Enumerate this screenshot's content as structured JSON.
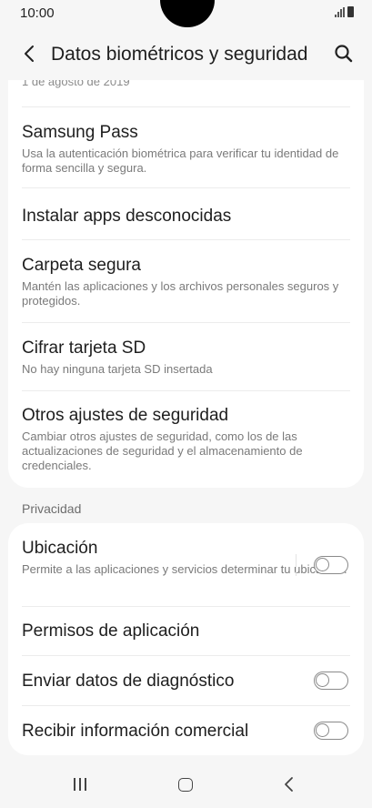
{
  "status_bar": {
    "time": "10:00"
  },
  "header": {
    "title": "Datos biométricos y seguridad"
  },
  "partial_row_text": "1 de agosto de 2019",
  "security_items": [
    {
      "title": "Samsung Pass",
      "subtitle": "Usa la autenticación biométrica para verificar tu identidad de forma sencilla y segura."
    },
    {
      "title": "Instalar apps desconocidas",
      "subtitle": ""
    },
    {
      "title": "Carpeta segura",
      "subtitle": "Mantén las aplicaciones y los archivos personales seguros y protegidos."
    },
    {
      "title": "Cifrar tarjeta SD",
      "subtitle": "No hay ninguna tarjeta SD insertada"
    },
    {
      "title": "Otros ajustes de seguridad",
      "subtitle": "Cambiar otros ajustes de seguridad, como los de las actualizaciones de seguridad y el almacenamiento de credenciales."
    }
  ],
  "privacy_section_label": "Privacidad",
  "privacy_items": [
    {
      "title": "Ubicación",
      "subtitle": "Permite a las aplicaciones y servicios determinar tu ubicación.",
      "toggle": "off"
    },
    {
      "title": "Permisos de aplicación",
      "subtitle": "",
      "toggle": "none"
    },
    {
      "title": "Enviar datos de diagnóstico",
      "subtitle": "",
      "toggle": "off"
    },
    {
      "title": "Recibir información comercial",
      "subtitle": "",
      "toggle": "off"
    }
  ],
  "icons": {
    "back": "chevron-left-icon",
    "search": "search-icon",
    "nav_recent": "recent-apps-icon",
    "nav_home": "home-icon",
    "nav_back": "nav-back-icon"
  }
}
